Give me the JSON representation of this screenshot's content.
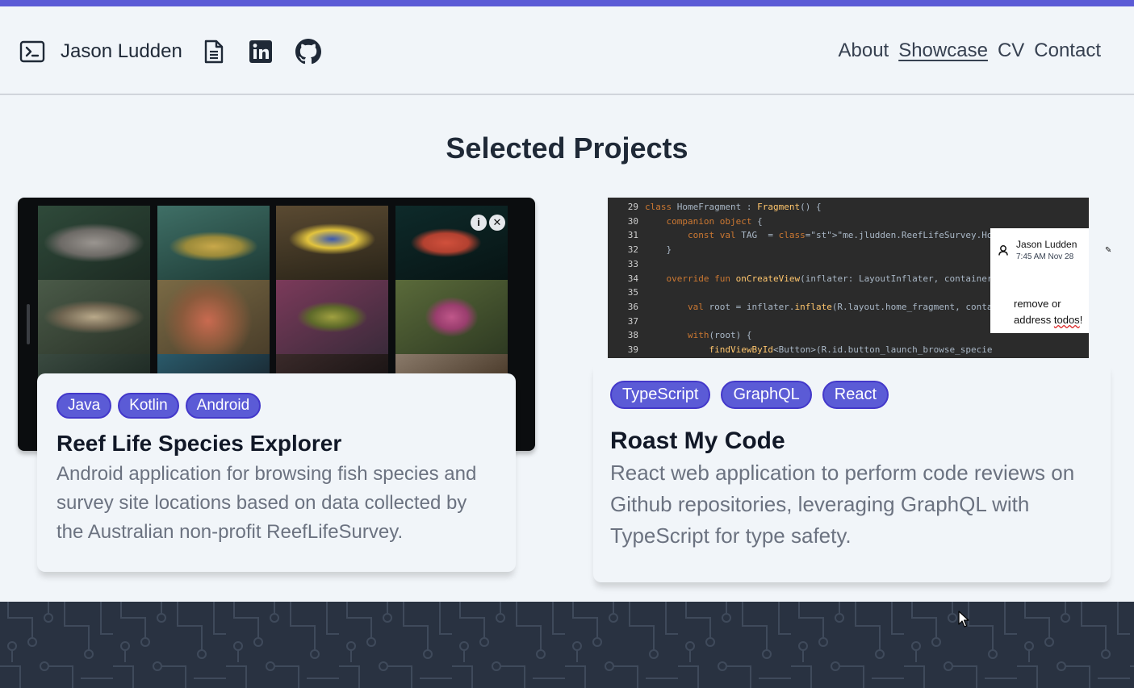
{
  "header": {
    "brand_name": "Jason Ludden",
    "icons": [
      "terminal-icon",
      "document-icon",
      "linkedin-icon",
      "github-icon"
    ],
    "nav": [
      {
        "label": "About",
        "active": false
      },
      {
        "label": "Showcase",
        "active": true
      },
      {
        "label": "CV",
        "active": false
      },
      {
        "label": "Contact",
        "active": false
      }
    ]
  },
  "main": {
    "title": "Selected Projects",
    "projects": [
      {
        "tags": [
          "Java",
          "Kotlin",
          "Android"
        ],
        "title": "Reef Life Species Explorer",
        "description": "Android application for browsing fish species and survey site locations based on data collected by the Australian non-profit ReefLifeSurvey.",
        "image_controls": [
          "info-icon",
          "close-icon"
        ]
      },
      {
        "tags": [
          "TypeScript",
          "GraphQL",
          "React"
        ],
        "title": "Roast My Code",
        "description": "React web application to perform code reviews on Github repositories, leveraging GraphQL with TypeScript for type safety.",
        "code_lines": [
          {
            "n": "29",
            "text": "class HomeFragment : Fragment() {"
          },
          {
            "n": "30",
            "text": "    companion object {"
          },
          {
            "n": "31",
            "text": "        const val TAG  = \"me.jludden.ReefLifeSurvey.HomeFragment\""
          },
          {
            "n": "32",
            "text": "    }"
          },
          {
            "n": "33",
            "text": ""
          },
          {
            "n": "34",
            "text": "    override fun onCreateView(inflater: LayoutInflater, container"
          },
          {
            "n": "35",
            "text": ""
          },
          {
            "n": "36",
            "text": "        val root = inflater.inflate(R.layout.home_fragment, conta"
          },
          {
            "n": "37",
            "text": ""
          },
          {
            "n": "38",
            "text": "        with(root) {"
          },
          {
            "n": "39",
            "text": "            findViewById<Button>(R.id.button_launch_browse_specie"
          }
        ],
        "comment": {
          "author": "Jason Ludden",
          "time": "7:45 AM Nov 28",
          "text_before": "remove or",
          "text_address": "address ",
          "text_todos": "todos",
          "text_end": "!"
        }
      }
    ]
  },
  "colors": {
    "accent": "#5b5bd6",
    "footer": "#293241",
    "background": "#f1f5f9"
  }
}
